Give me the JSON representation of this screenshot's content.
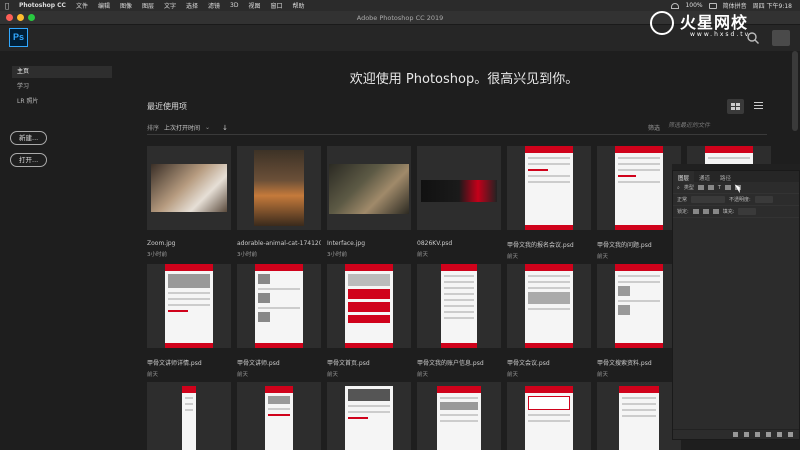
{
  "menubar": {
    "app": "Photoshop CC",
    "items": [
      "文件",
      "编辑",
      "图像",
      "图层",
      "文字",
      "选择",
      "滤镜",
      "3D",
      "视图",
      "窗口",
      "帮助"
    ],
    "ime": "简体拼音",
    "battery": "100%",
    "clock": "周四 下午9:18"
  },
  "window": {
    "title": "Adobe Photoshop CC 2019"
  },
  "ps": {
    "logo": "Ps"
  },
  "watermark": {
    "text": "火星网校",
    "sub": "www.hxsd.tv"
  },
  "nav": {
    "items": [
      "主页",
      "学习",
      "LR 照片"
    ],
    "new_label": "新建...",
    "open_label": "打开..."
  },
  "main": {
    "welcome": "欢迎使用 Photoshop。很高兴见到你。",
    "recent": "最近使用项",
    "sort_label": "排序",
    "sort_value": "上次打开时间",
    "filter_label": "筛选",
    "filter_placeholder": "筛选最近的文件"
  },
  "files": [
    {
      "name": "Zoom.jpg",
      "time": "3小时前"
    },
    {
      "name": "adorable-animal-cat-1741205...",
      "time": "3小时前"
    },
    {
      "name": "Interface.jpg",
      "time": "3小时前"
    },
    {
      "name": "0826KV.psd",
      "time": "前天"
    },
    {
      "name": "甲骨文我的报名会议.psd",
      "time": "前天"
    },
    {
      "name": "甲骨文我的问题.psd",
      "time": "前天"
    },
    {
      "name": "甲骨文讲师详情.psd",
      "time": "前天"
    },
    {
      "name": "甲骨文讲师.psd",
      "time": "前天"
    },
    {
      "name": "甲骨文首页.psd",
      "time": "前天"
    },
    {
      "name": "甲骨文我的账户信息.psd",
      "time": "前天"
    },
    {
      "name": "甲骨文会议.psd",
      "time": "前天"
    },
    {
      "name": "甲骨文搜索资料.psd",
      "time": "前天"
    }
  ],
  "panel": {
    "tabs": [
      "图层",
      "通道",
      "路径"
    ],
    "kind_label": "类型",
    "blend_label": "正常",
    "opacity_label": "不透明度:",
    "lock_label": "锁定:",
    "fill_label": "填充:"
  }
}
